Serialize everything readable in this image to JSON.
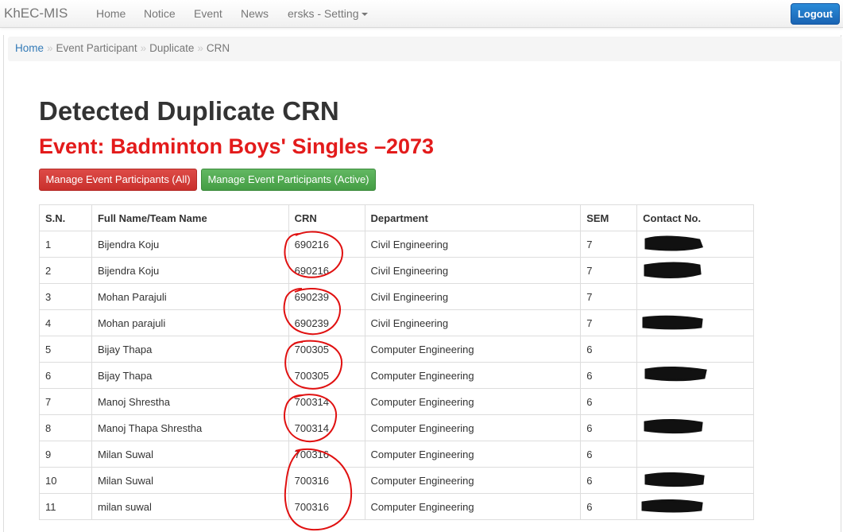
{
  "navbar": {
    "brand": "KhEC-MIS",
    "links": [
      "Home",
      "Notice",
      "Event",
      "News"
    ],
    "setting_label": "ersks - Setting",
    "logout_label": "Logout"
  },
  "breadcrumb": [
    "Home",
    "Event Participant",
    "Duplicate",
    "CRN"
  ],
  "breadcrumb_separator": "»",
  "page_title": "Detected Duplicate CRN",
  "event_title": "Event: Badminton Boys' Singles –2073",
  "buttons": {
    "manage_all": "Manage Event Participants (All)",
    "manage_active": "Manage Event Participants (Active)"
  },
  "colors": {
    "accent_red": "#e31b1b",
    "btn_red": "#d9534f",
    "btn_green": "#5cb85c",
    "link_blue": "#337ab7",
    "logout_blue": "#1a6fc4"
  },
  "table": {
    "headers": [
      "S.N.",
      "Full Name/Team Name",
      "CRN",
      "Department",
      "SEM",
      "Contact No."
    ],
    "rows": [
      {
        "sn": "1",
        "name": "Bijendra Koju",
        "crn": "690216",
        "dept": "Civil Engineering",
        "sem": "7",
        "contact": ""
      },
      {
        "sn": "2",
        "name": "Bijendra Koju",
        "crn": "690216",
        "dept": "Civil Engineering",
        "sem": "7",
        "contact": ""
      },
      {
        "sn": "3",
        "name": "Mohan Parajuli",
        "crn": "690239",
        "dept": "Civil Engineering",
        "sem": "7",
        "contact": ""
      },
      {
        "sn": "4",
        "name": "Mohan parajuli",
        "crn": "690239",
        "dept": "Civil Engineering",
        "sem": "7",
        "contact": ""
      },
      {
        "sn": "5",
        "name": "Bijay Thapa",
        "crn": "700305",
        "dept": "Computer Engineering",
        "sem": "6",
        "contact": ""
      },
      {
        "sn": "6",
        "name": "Bijay Thapa",
        "crn": "700305",
        "dept": "Computer Engineering",
        "sem": "6",
        "contact": ""
      },
      {
        "sn": "7",
        "name": "Manoj Shrestha",
        "crn": "700314",
        "dept": "Computer Engineering",
        "sem": "6",
        "contact": ""
      },
      {
        "sn": "8",
        "name": "Manoj Thapa Shrestha",
        "crn": "700314",
        "dept": "Computer Engineering",
        "sem": "6",
        "contact": ""
      },
      {
        "sn": "9",
        "name": "Milan Suwal",
        "crn": "700316",
        "dept": "Computer Engineering",
        "sem": "6",
        "contact": ""
      },
      {
        "sn": "10",
        "name": "Milan Suwal",
        "crn": "700316",
        "dept": "Computer Engineering",
        "sem": "6",
        "contact": ""
      },
      {
        "sn": "11",
        "name": "milan suwal",
        "crn": "700316",
        "dept": "Computer Engineering",
        "sem": "6",
        "contact": ""
      }
    ]
  }
}
